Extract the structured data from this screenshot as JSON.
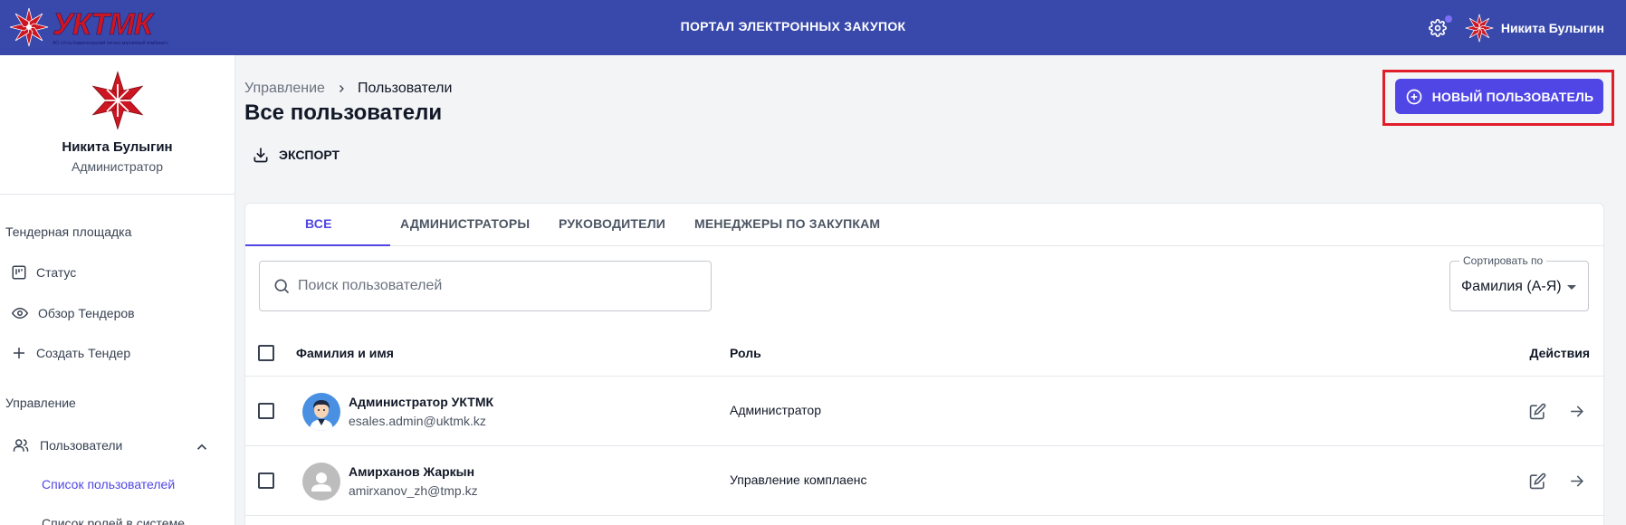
{
  "header": {
    "logo_text": "УКТМК",
    "logo_subtitle": "АО «Усть-Каменогорский титано-магниевый комбинат»",
    "portal_title": "ПОРТАЛ ЭЛЕКТРОННЫХ ЗАКУПОК",
    "user_name": "Никита Булыгин",
    "accent_color": "#3949ab"
  },
  "sidebar": {
    "profile_name": "Никита Булыгин",
    "profile_role": "Администратор",
    "sections": [
      {
        "title": "Тендерная площадка",
        "items": [
          {
            "label": "Статус",
            "icon": "board-icon"
          },
          {
            "label": "Обзор Тендеров",
            "icon": "eye-icon"
          },
          {
            "label": "Создать Тендер",
            "icon": "plus-icon"
          }
        ]
      },
      {
        "title": "Управление",
        "items": [
          {
            "label": "Пользователи",
            "icon": "users-icon",
            "expanded": true
          }
        ]
      }
    ],
    "sub_items": [
      {
        "label": "Список пользователей",
        "active": true
      },
      {
        "label": "Список ролей в системе",
        "active": false
      }
    ]
  },
  "main": {
    "breadcrumb": [
      "Управление",
      "Пользователи"
    ],
    "title": "Все пользователи",
    "export_label": "ЭКСПОРТ",
    "new_user_label": "НОВЫЙ ПОЛЬЗОВАТЕЛЬ",
    "primary_color": "#5046e5",
    "highlight_color": "#e11d2a",
    "tabs": [
      {
        "label": "ВСЕ",
        "active": true
      },
      {
        "label": "АДМИНИСТРАТОРЫ",
        "active": false
      },
      {
        "label": "РУКОВОДИТЕЛИ",
        "active": false
      },
      {
        "label": "МЕНЕДЖЕРЫ ПО ЗАКУПКАМ",
        "active": false
      }
    ],
    "search": {
      "placeholder": "Поиск пользователей",
      "value": ""
    },
    "sort": {
      "label": "Сортировать по",
      "value": "Фамилия (А-Я)"
    },
    "table": {
      "headers": {
        "name": "Фамилия и имя",
        "role": "Роль",
        "actions": "Действия"
      },
      "rows": [
        {
          "name": "Администратор УКТМК",
          "email": "esales.admin@uktmk.kz",
          "role": "Администратор",
          "avatar": "person-avatar"
        },
        {
          "name": "Амирханов Жаркын",
          "email": "amirxanov_zh@tmp.kz",
          "role": "Управление комплаенс",
          "avatar": "default-avatar"
        }
      ]
    }
  }
}
